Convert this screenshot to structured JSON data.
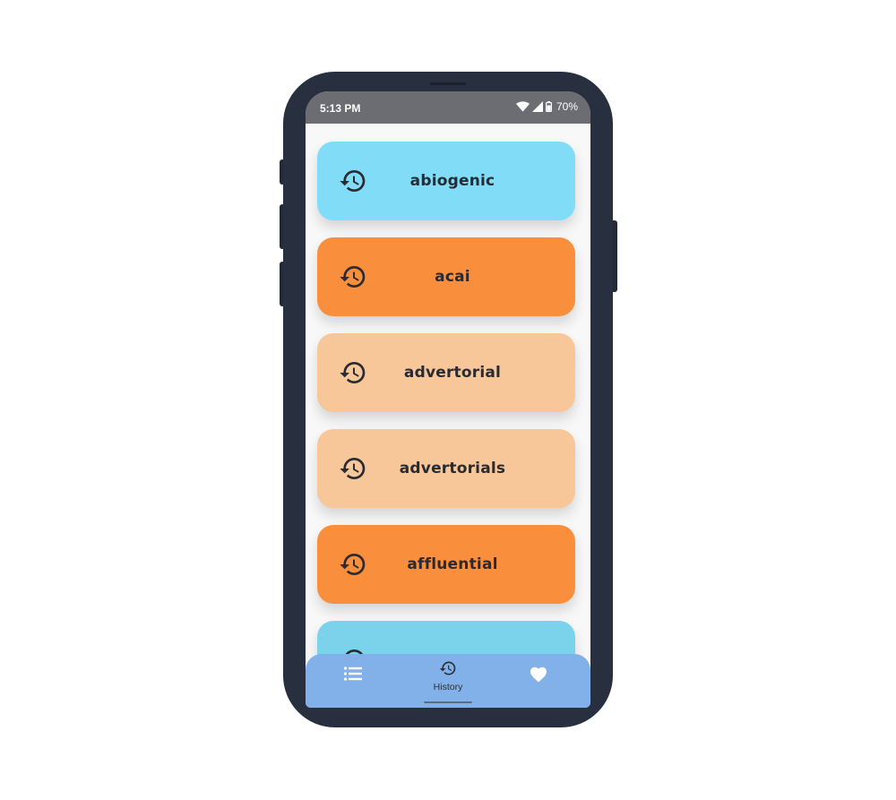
{
  "status_bar": {
    "time": "5:13 PM",
    "battery": "70%",
    "icons": [
      "wifi-icon",
      "signal-icon",
      "battery-icon"
    ]
  },
  "history_items": [
    {
      "word": "abiogenic",
      "color": "#80dcf7",
      "icon": "history-icon"
    },
    {
      "word": "acai",
      "color": "#f98f3d",
      "icon": "history-icon"
    },
    {
      "word": "advertorial",
      "color": "#f7c699",
      "icon": "history-icon"
    },
    {
      "word": "advertorials",
      "color": "#f7c699",
      "icon": "history-icon"
    },
    {
      "word": "affluential",
      "color": "#f98f3d",
      "icon": "history-icon"
    },
    {
      "word": "",
      "color": "#7ad3ea",
      "icon": "history-icon"
    }
  ],
  "bottom_nav": {
    "items": [
      {
        "icon": "list-icon",
        "label": ""
      },
      {
        "icon": "history-icon",
        "label": "History"
      },
      {
        "icon": "heart-icon",
        "label": ""
      }
    ],
    "background": "#82b0e8"
  },
  "colors": {
    "phone_frame": "#283040",
    "status_bar": "#6b6d72",
    "text": "#2a2a32"
  }
}
